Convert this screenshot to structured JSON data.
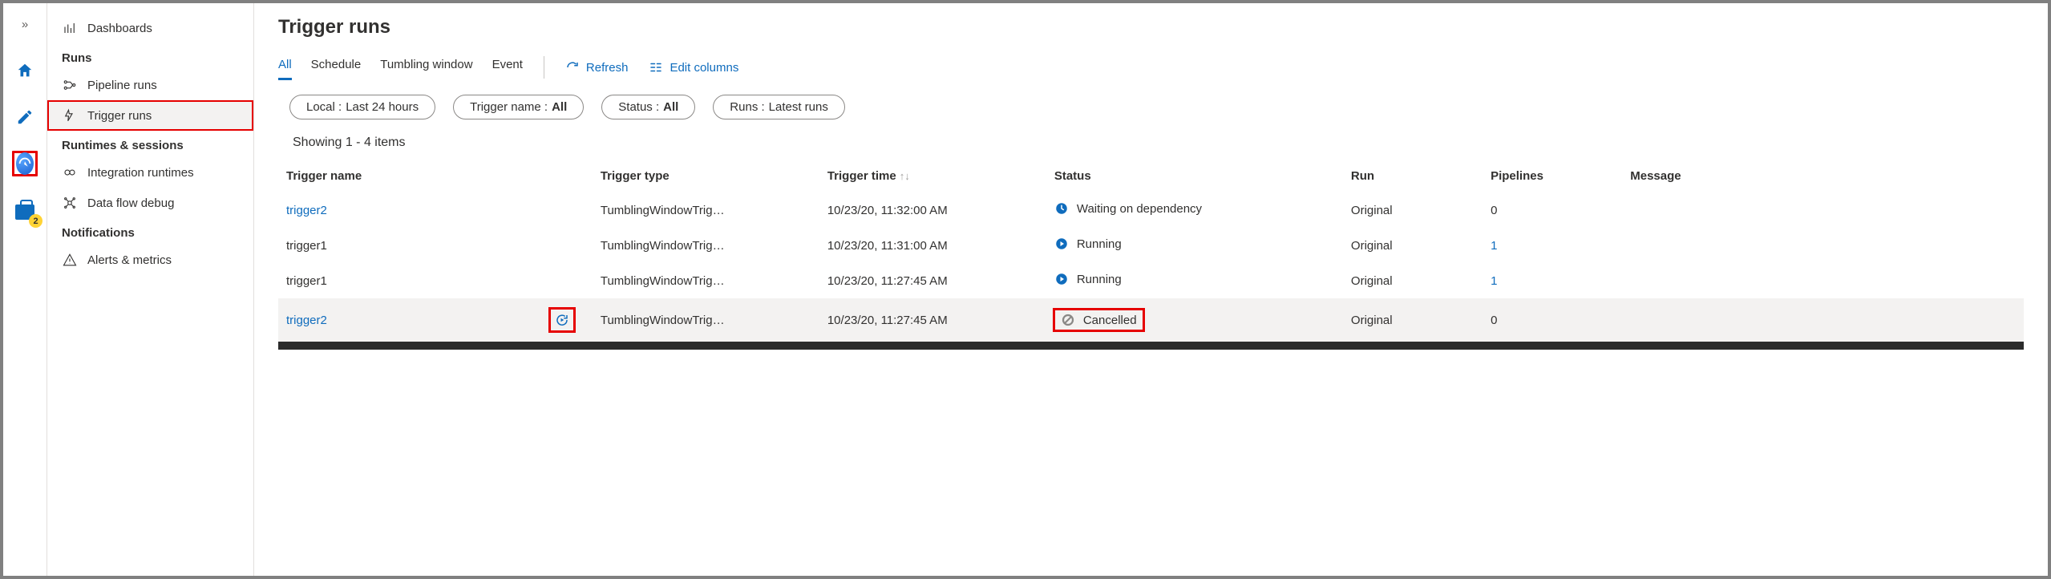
{
  "rail": {
    "toolbox_badge": "2"
  },
  "sidebar": {
    "dashboards": "Dashboards",
    "runs_header": "Runs",
    "pipeline_runs": "Pipeline runs",
    "trigger_runs": "Trigger runs",
    "runtimes_header": "Runtimes & sessions",
    "integration_runtimes": "Integration runtimes",
    "data_flow_debug": "Data flow debug",
    "notifications_header": "Notifications",
    "alerts_metrics": "Alerts & metrics"
  },
  "header": {
    "title": "Trigger runs"
  },
  "tabs": {
    "all": "All",
    "schedule": "Schedule",
    "tumbling": "Tumbling window",
    "event": "Event"
  },
  "commands": {
    "refresh": "Refresh",
    "edit_columns": "Edit columns"
  },
  "filters": {
    "local_k": "Local :",
    "local_v": "Last 24 hours",
    "trigger_k": "Trigger name :",
    "trigger_v": "All",
    "status_k": "Status :",
    "status_v": "All",
    "runs_k": "Runs :",
    "runs_v": "Latest runs"
  },
  "summary": "Showing 1 - 4 items",
  "columns": {
    "name": "Trigger name",
    "type": "Trigger type",
    "time": "Trigger time",
    "status": "Status",
    "run": "Run",
    "pipelines": "Pipelines",
    "message": "Message"
  },
  "rows": [
    {
      "name": "trigger2",
      "name_link": true,
      "type": "TumblingWindowTrig…",
      "time": "10/23/20, 11:32:00 AM",
      "status": "Waiting on dependency",
      "status_kind": "waiting",
      "run": "Original",
      "pipelines": "0",
      "pipe_link": false,
      "message": ""
    },
    {
      "name": "trigger1",
      "name_link": false,
      "type": "TumblingWindowTrig…",
      "time": "10/23/20, 11:31:00 AM",
      "status": "Running",
      "status_kind": "running",
      "run": "Original",
      "pipelines": "1",
      "pipe_link": true,
      "message": ""
    },
    {
      "name": "trigger1",
      "name_link": false,
      "type": "TumblingWindowTrig…",
      "time": "10/23/20, 11:27:45 AM",
      "status": "Running",
      "status_kind": "running",
      "run": "Original",
      "pipelines": "1",
      "pipe_link": true,
      "message": ""
    },
    {
      "name": "trigger2",
      "name_link": true,
      "type": "TumblingWindowTrig…",
      "time": "10/23/20, 11:27:45 AM",
      "status": "Cancelled",
      "status_kind": "cancelled",
      "run": "Original",
      "pipelines": "0",
      "pipe_link": false,
      "message": "",
      "hovered": true,
      "show_rerun": true
    }
  ]
}
